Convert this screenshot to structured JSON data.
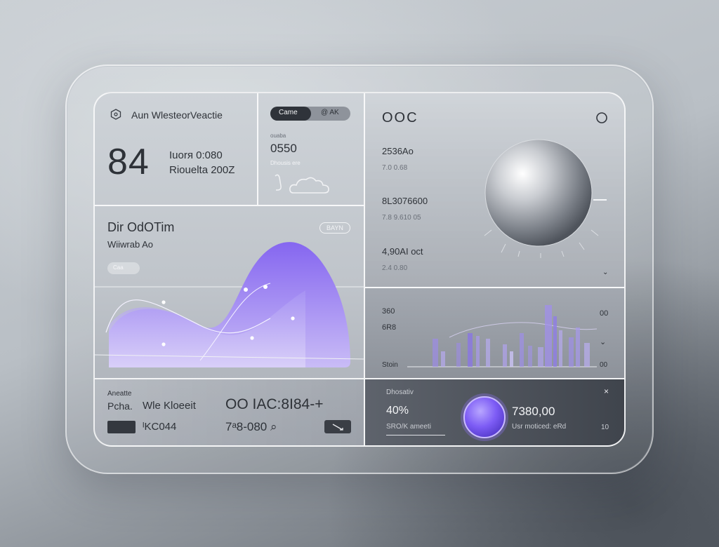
{
  "weather": {
    "title": "Aun WlesteorVeactie",
    "big_value": "84",
    "line1": "Iuorя 0:080",
    "line2": "Riouelta 200Z"
  },
  "mini": {
    "toggle_left": "Came",
    "toggle_right": "@ AK",
    "small_label": "ouaba",
    "value": "0550",
    "sub_label": "Dhousis ere"
  },
  "graph": {
    "title": "Dir OdOTim",
    "subtitle": "Wiiwrab Ao",
    "badge": "BAYN",
    "button_label": "Caa"
  },
  "bottom_left": {
    "label": "Aneatte",
    "row1_left": "Pcha.",
    "row1_mid": "Wle Kloeeit",
    "row1_right": "OO IAC:8I84-+",
    "row2_left": "ᴵKC044",
    "row2_right": "7ᵃ8-080 ⌕"
  },
  "right_top": {
    "header": "OOC",
    "stats": [
      {
        "value": "2536Ao",
        "sub": "7.0 0.68"
      },
      {
        "value": "8L3076600",
        "sub": "7.8 9.610 05"
      },
      {
        "value": "4,90AI oct",
        "sub": "2.4 0.80"
      }
    ]
  },
  "right_chart": {
    "y_top": "360",
    "y_mid": "6R8",
    "x_label": "Stoin",
    "right_top": "00",
    "right_bottom": "00"
  },
  "right_bottom": {
    "label": "Dhosativ",
    "percent": "40%",
    "percent_sub": "SRO/K ameeti",
    "amount": "7380,00",
    "amount_sub": "Usr moticed: eRd",
    "corner": "10",
    "close": "×"
  },
  "colors": {
    "accent": "#8b72f0",
    "accent_light": "#b9a9f7"
  }
}
